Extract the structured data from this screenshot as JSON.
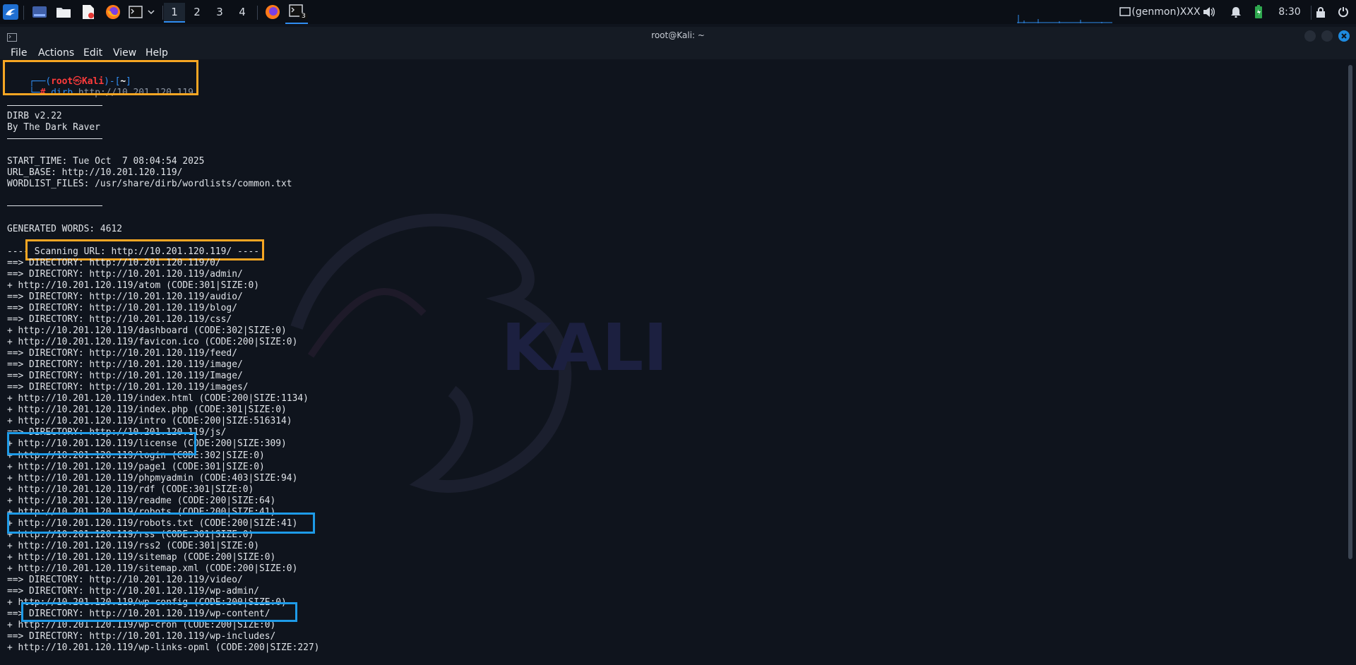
{
  "taskbar": {
    "workspaces": [
      "1",
      "2",
      "3",
      "4"
    ],
    "active_workspace": "1",
    "terminal_badge": "3",
    "genmon": "(genmon)XXX",
    "clock": "8:30",
    "icons": [
      "kali-menu-icon",
      "desktop-icon",
      "file-manager-icon",
      "text-editor-icon",
      "firefox-icon",
      "terminal-icon",
      "dropdown-chevron-icon"
    ]
  },
  "window": {
    "title": "root@Kali: ~"
  },
  "menu": [
    "File",
    "Actions",
    "Edit",
    "View",
    "Help"
  ],
  "prompt": {
    "user": "root",
    "at": "㉿",
    "host": "Kali",
    "dir": "~",
    "command": "dirb",
    "argument": "http://10.201.120.119"
  },
  "output": {
    "banner": [
      "DIRB v2.22",
      "By The Dark Raver"
    ],
    "info": [
      "START_TIME: Tue Oct  7 08:04:54 2025",
      "URL_BASE: http://10.201.120.119/",
      "WORDLIST_FILES: /usr/share/dirb/wordlists/common.txt"
    ],
    "generated": "GENERATED WORDS: 4612",
    "scanning": "---- Scanning URL: http://10.201.120.119/ ----",
    "results": [
      "==> DIRECTORY: http://10.201.120.119/0/",
      "==> DIRECTORY: http://10.201.120.119/admin/",
      "+ http://10.201.120.119/atom (CODE:301|SIZE:0)",
      "==> DIRECTORY: http://10.201.120.119/audio/",
      "==> DIRECTORY: http://10.201.120.119/blog/",
      "==> DIRECTORY: http://10.201.120.119/css/",
      "+ http://10.201.120.119/dashboard (CODE:302|SIZE:0)",
      "+ http://10.201.120.119/favicon.ico (CODE:200|SIZE:0)",
      "==> DIRECTORY: http://10.201.120.119/feed/",
      "==> DIRECTORY: http://10.201.120.119/image/",
      "==> DIRECTORY: http://10.201.120.119/Image/",
      "==> DIRECTORY: http://10.201.120.119/images/",
      "+ http://10.201.120.119/index.html (CODE:200|SIZE:1134)",
      "+ http://10.201.120.119/index.php (CODE:301|SIZE:0)",
      "+ http://10.201.120.119/intro (CODE:200|SIZE:516314)",
      "==> DIRECTORY: http://10.201.120.119/js/",
      "+ http://10.201.120.119/license (CODE:200|SIZE:309)",
      "+ http://10.201.120.119/login (CODE:302|SIZE:0)",
      "+ http://10.201.120.119/page1 (CODE:301|SIZE:0)",
      "+ http://10.201.120.119/phpmyadmin (CODE:403|SIZE:94)",
      "+ http://10.201.120.119/rdf (CODE:301|SIZE:0)",
      "+ http://10.201.120.119/readme (CODE:200|SIZE:64)",
      "+ http://10.201.120.119/robots (CODE:200|SIZE:41)",
      "+ http://10.201.120.119/robots.txt (CODE:200|SIZE:41)",
      "+ http://10.201.120.119/rss (CODE:301|SIZE:0)",
      "+ http://10.201.120.119/rss2 (CODE:301|SIZE:0)",
      "+ http://10.201.120.119/sitemap (CODE:200|SIZE:0)",
      "+ http://10.201.120.119/sitemap.xml (CODE:200|SIZE:0)",
      "==> DIRECTORY: http://10.201.120.119/video/",
      "==> DIRECTORY: http://10.201.120.119/wp-admin/",
      "+ http://10.201.120.119/wp-config (CODE:200|SIZE:0)",
      "==> DIRECTORY: http://10.201.120.119/wp-content/",
      "+ http://10.201.120.119/wp-cron (CODE:200|SIZE:0)",
      "==> DIRECTORY: http://10.201.120.119/wp-includes/",
      "+ http://10.201.120.119/wp-links-opml (CODE:200|SIZE:227)"
    ]
  },
  "watermark": {
    "text": "KALI"
  },
  "colors": {
    "prompt_red": "#ff3b3b",
    "prompt_blue": "#2f8cf0",
    "highlight_orange": "#f6a623",
    "highlight_blue": "#1e9be8"
  }
}
